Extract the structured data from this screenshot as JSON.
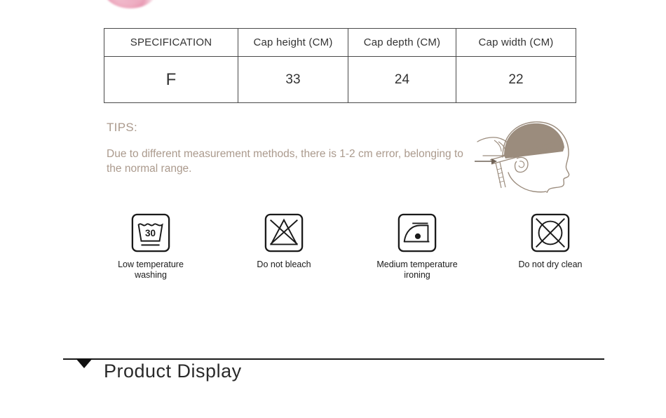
{
  "page": {
    "background_color": "#ffffff"
  },
  "top_image": {
    "alt": "pink-pompom-partial",
    "color": "#e89bb4"
  },
  "spec_table": {
    "headers": [
      "SPECIFICATION",
      "Cap height (CM)",
      "Cap depth (CM)",
      "Cap width (CM)"
    ],
    "rows": [
      [
        "F",
        "33",
        "24",
        "22"
      ]
    ],
    "border_color": "#4a4a4a"
  },
  "tips": {
    "title": "TIPS:",
    "body": "Due to different measurement methods, there is 1-2 cm error, belonging to the normal range.",
    "color": "#ab9a8d"
  },
  "head_diagram": {
    "alt": "head-profile-measuring-tape",
    "fill_color": "#9b8c7d"
  },
  "care_symbols": [
    {
      "icon": "wash-tub-30-icon",
      "label": "Low temperature\nwashing",
      "temperature": "30"
    },
    {
      "icon": "do-not-bleach-icon",
      "label": "Do not bleach"
    },
    {
      "icon": "iron-medium-icon",
      "label": "Medium temperature\nironing"
    },
    {
      "icon": "do-not-dry-clean-icon",
      "label": "Do not dry clean"
    }
  ],
  "section": {
    "title": "Product  Display",
    "marker": "down-triangle",
    "rule_color": "#1a1a1a"
  }
}
